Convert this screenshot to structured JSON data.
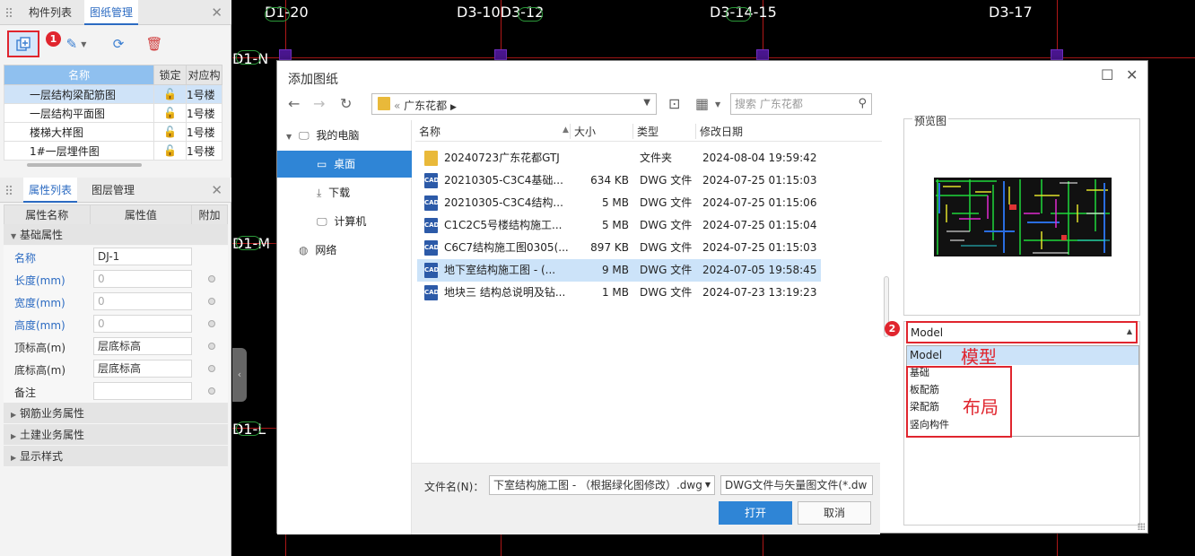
{
  "left_panel": {
    "top_tabs": [
      "构件列表",
      "图纸管理"
    ],
    "drawings_table": {
      "headers": [
        "名称",
        "锁定",
        "对应构"
      ],
      "rows": [
        {
          "name": "一层结构梁配筋图",
          "corr": "1号楼"
        },
        {
          "name": "一层结构平面图",
          "corr": "1号楼"
        },
        {
          "name": "楼梯大样图",
          "corr": "1号楼"
        },
        {
          "name": "1#一层埋件图",
          "corr": "1号楼"
        }
      ]
    },
    "badge1": "1",
    "prop_tabs": [
      "属性列表",
      "图层管理"
    ],
    "prop_headers": [
      "属性名称",
      "属性值",
      "附加"
    ],
    "group_basic": "基础属性",
    "props": [
      {
        "name": "名称",
        "value": "DJ-1"
      },
      {
        "name": "长度(mm)",
        "value": "0"
      },
      {
        "name": "宽度(mm)",
        "value": "0"
      },
      {
        "name": "高度(mm)",
        "value": "0"
      },
      {
        "name": "顶标高(m)",
        "value": "层底标高"
      },
      {
        "name": "底标高(m)",
        "value": "层底标高"
      },
      {
        "name": "备注",
        "value": ""
      }
    ],
    "groups_collapsed": [
      "钢筋业务属性",
      "土建业务属性",
      "显示样式"
    ]
  },
  "cad": {
    "axis_top": [
      "D1-20",
      "D3-10D3-12",
      "D3-14-15",
      "D3-17"
    ],
    "axis_left": [
      "D1-N",
      "D1-M",
      "D1-L"
    ]
  },
  "dialog": {
    "title": "添加图纸",
    "address": "广东花都",
    "search_placeholder": "搜索 广东花都",
    "nav": [
      "我的电脑",
      "桌面",
      "下载",
      "计算机",
      "网络"
    ],
    "columns": [
      "名称",
      "大小",
      "类型",
      "修改日期"
    ],
    "files": [
      {
        "icon": "folder",
        "name": "20240723广东花都GTJ",
        "size": "",
        "type": "文件夹",
        "date": "2024-08-04 19:59:42"
      },
      {
        "icon": "CAD",
        "name": "20210305-C3C4基础...",
        "size": "634 KB",
        "type": "DWG 文件",
        "date": "2024-07-25 01:15:03"
      },
      {
        "icon": "CAD",
        "name": "20210305-C3C4结构...",
        "size": "5 MB",
        "type": "DWG 文件",
        "date": "2024-07-25 01:15:06"
      },
      {
        "icon": "CAD",
        "name": "C1C2C5号楼结构施工...",
        "size": "5 MB",
        "type": "DWG 文件",
        "date": "2024-07-25 01:15:04"
      },
      {
        "icon": "CAD",
        "name": "C6C7结构施工图0305(...",
        "size": "897 KB",
        "type": "DWG 文件",
        "date": "2024-07-25 01:15:03"
      },
      {
        "icon": "CAD",
        "name": "地下室结构施工图 - (...",
        "size": "9 MB",
        "type": "DWG 文件",
        "date": "2024-07-05 19:58:45"
      },
      {
        "icon": "CAD",
        "name": "地块三 结构总说明及钻...",
        "size": "1 MB",
        "type": "DWG 文件",
        "date": "2024-07-23 13:19:23"
      }
    ],
    "filename_label": "文件名(N)：",
    "filename_value": "下室结构施工图 - （根据绿化图修改）.dwg",
    "filetype_value": "DWG文件与矢量图文件(*.dw",
    "open_label": "打开",
    "cancel_label": "取消",
    "preview_label": "预览图",
    "layout_selected": "Model",
    "layout_options": [
      "Model",
      "基础",
      "板配筋",
      "梁配筋",
      "竖向构件"
    ],
    "badge2": "2",
    "annotation_model": "模型",
    "annotation_layout": "布局"
  },
  "colors": {
    "accent": "#2f85d6",
    "highlight": "#e0252e"
  }
}
